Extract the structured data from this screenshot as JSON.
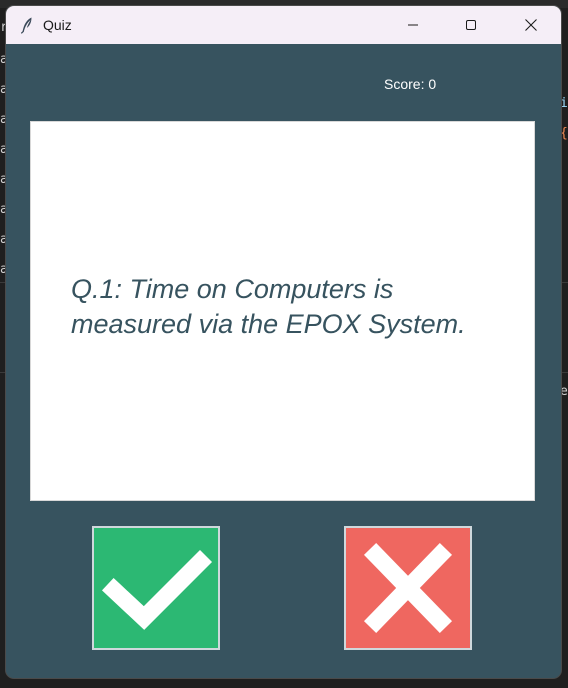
{
  "window": {
    "title": "Quiz",
    "controls": [
      "minimize-icon",
      "maximize-icon",
      "close-icon"
    ]
  },
  "score": {
    "label": "Score: 0"
  },
  "question": {
    "text": "Q.1: Time on Computers is measured via the EPOX System."
  },
  "buttons": {
    "true_icon": "checkmark-icon",
    "false_icon": "cross-icon"
  },
  "colors": {
    "window_bg": "#37535f",
    "card_bg": "#ffffff",
    "question_text": "#37535f",
    "true_button": "#2cb873",
    "false_button": "#ef6760",
    "titlebar": "#f5eef7"
  },
  "background": {
    "left_chars": [
      "r",
      "a",
      "a",
      "a",
      "a",
      "a",
      "a",
      "a",
      "a"
    ],
    "right_chars": [
      "i",
      "{",
      "e"
    ]
  }
}
